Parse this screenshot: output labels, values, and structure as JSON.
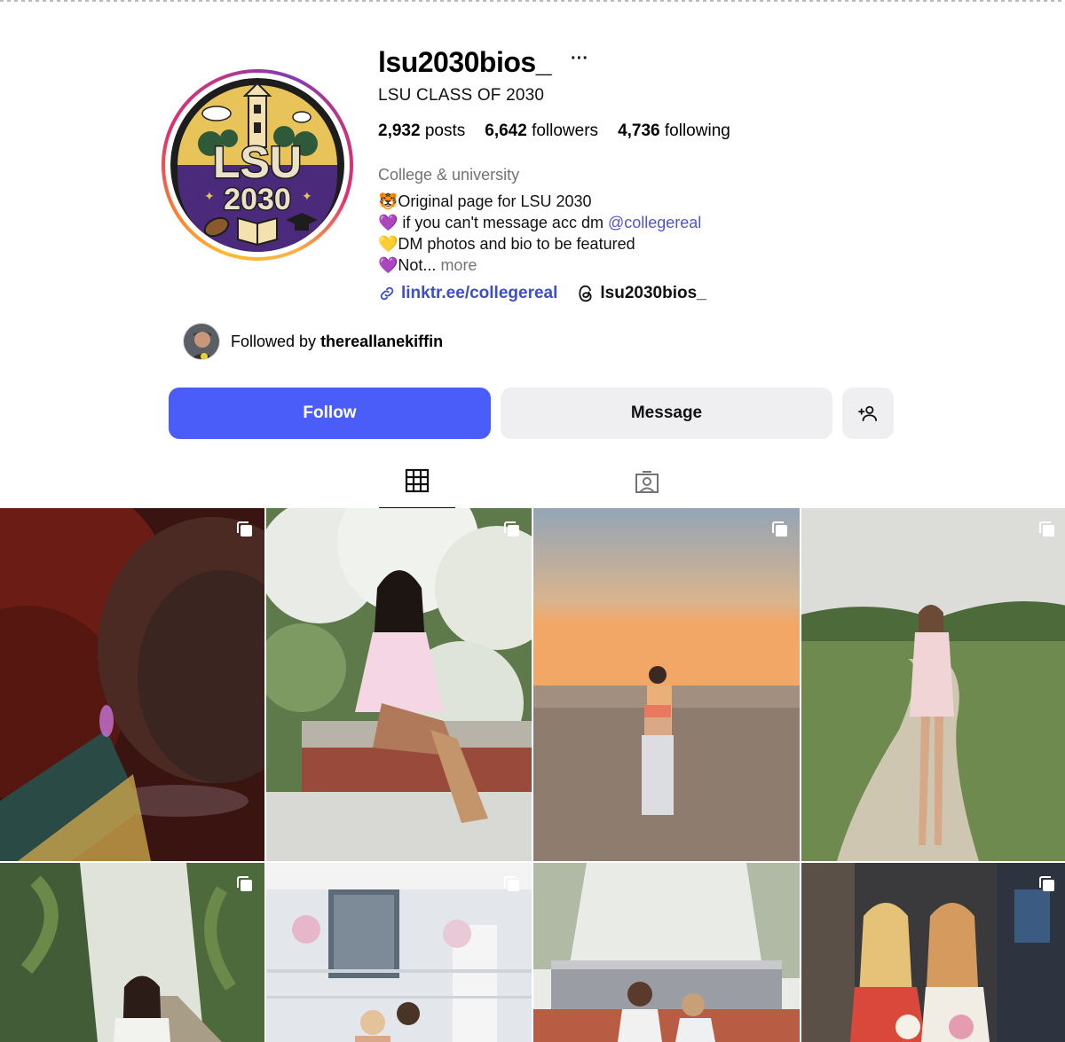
{
  "profile": {
    "username": "lsu2030bios_",
    "more_label": "···",
    "full_name": "LSU CLASS OF 2030",
    "stats": {
      "posts_count": "2,932",
      "posts_label": "posts",
      "followers_count": "6,642",
      "followers_label": "followers",
      "following_count": "4,736",
      "following_label": "following"
    },
    "category": "College & university",
    "bio": {
      "line1": "🐯Original page for LSU 2030",
      "line2_text": "💜 if you can't message acc dm ",
      "line2_mention": "@collegereal",
      "line3": "💛DM photos and bio to be featured",
      "line4_text": "💜Not... ",
      "line4_more": "more"
    },
    "link_url": "linktr.ee/collegereal",
    "threads_handle": "lsu2030bios_",
    "avatar_logo": {
      "top_text": "LSU",
      "bottom_text": "2030"
    }
  },
  "followed_by": {
    "prefix": "Followed by ",
    "user": "thereallanekiffin"
  },
  "actions": {
    "follow_label": "Follow",
    "message_label": "Message",
    "add_user_icon": "person-plus-icon"
  },
  "tabs": [
    {
      "name": "posts",
      "icon": "grid-icon",
      "active": true
    },
    {
      "name": "tagged",
      "icon": "tagged-person-icon",
      "active": false
    }
  ],
  "posts": [
    {
      "type": "carousel",
      "icon": "multiple-photos-icon"
    },
    {
      "type": "carousel",
      "icon": "multiple-photos-icon"
    },
    {
      "type": "carousel",
      "icon": "multiple-photos-icon"
    },
    {
      "type": "carousel",
      "icon": "multiple-photos-icon"
    },
    {
      "type": "carousel",
      "icon": "multiple-photos-icon"
    },
    {
      "type": "carousel",
      "icon": "multiple-photos-icon"
    },
    {
      "type": "single",
      "icon": ""
    },
    {
      "type": "carousel",
      "icon": "multiple-photos-icon"
    }
  ],
  "colors": {
    "follow_button": "#4a5df9",
    "secondary_button": "#efeff1",
    "link": "#3d4fc6",
    "muted_text": "#737373",
    "lsu_purple": "#4b2a7b",
    "lsu_gold": "#e8b84a"
  }
}
